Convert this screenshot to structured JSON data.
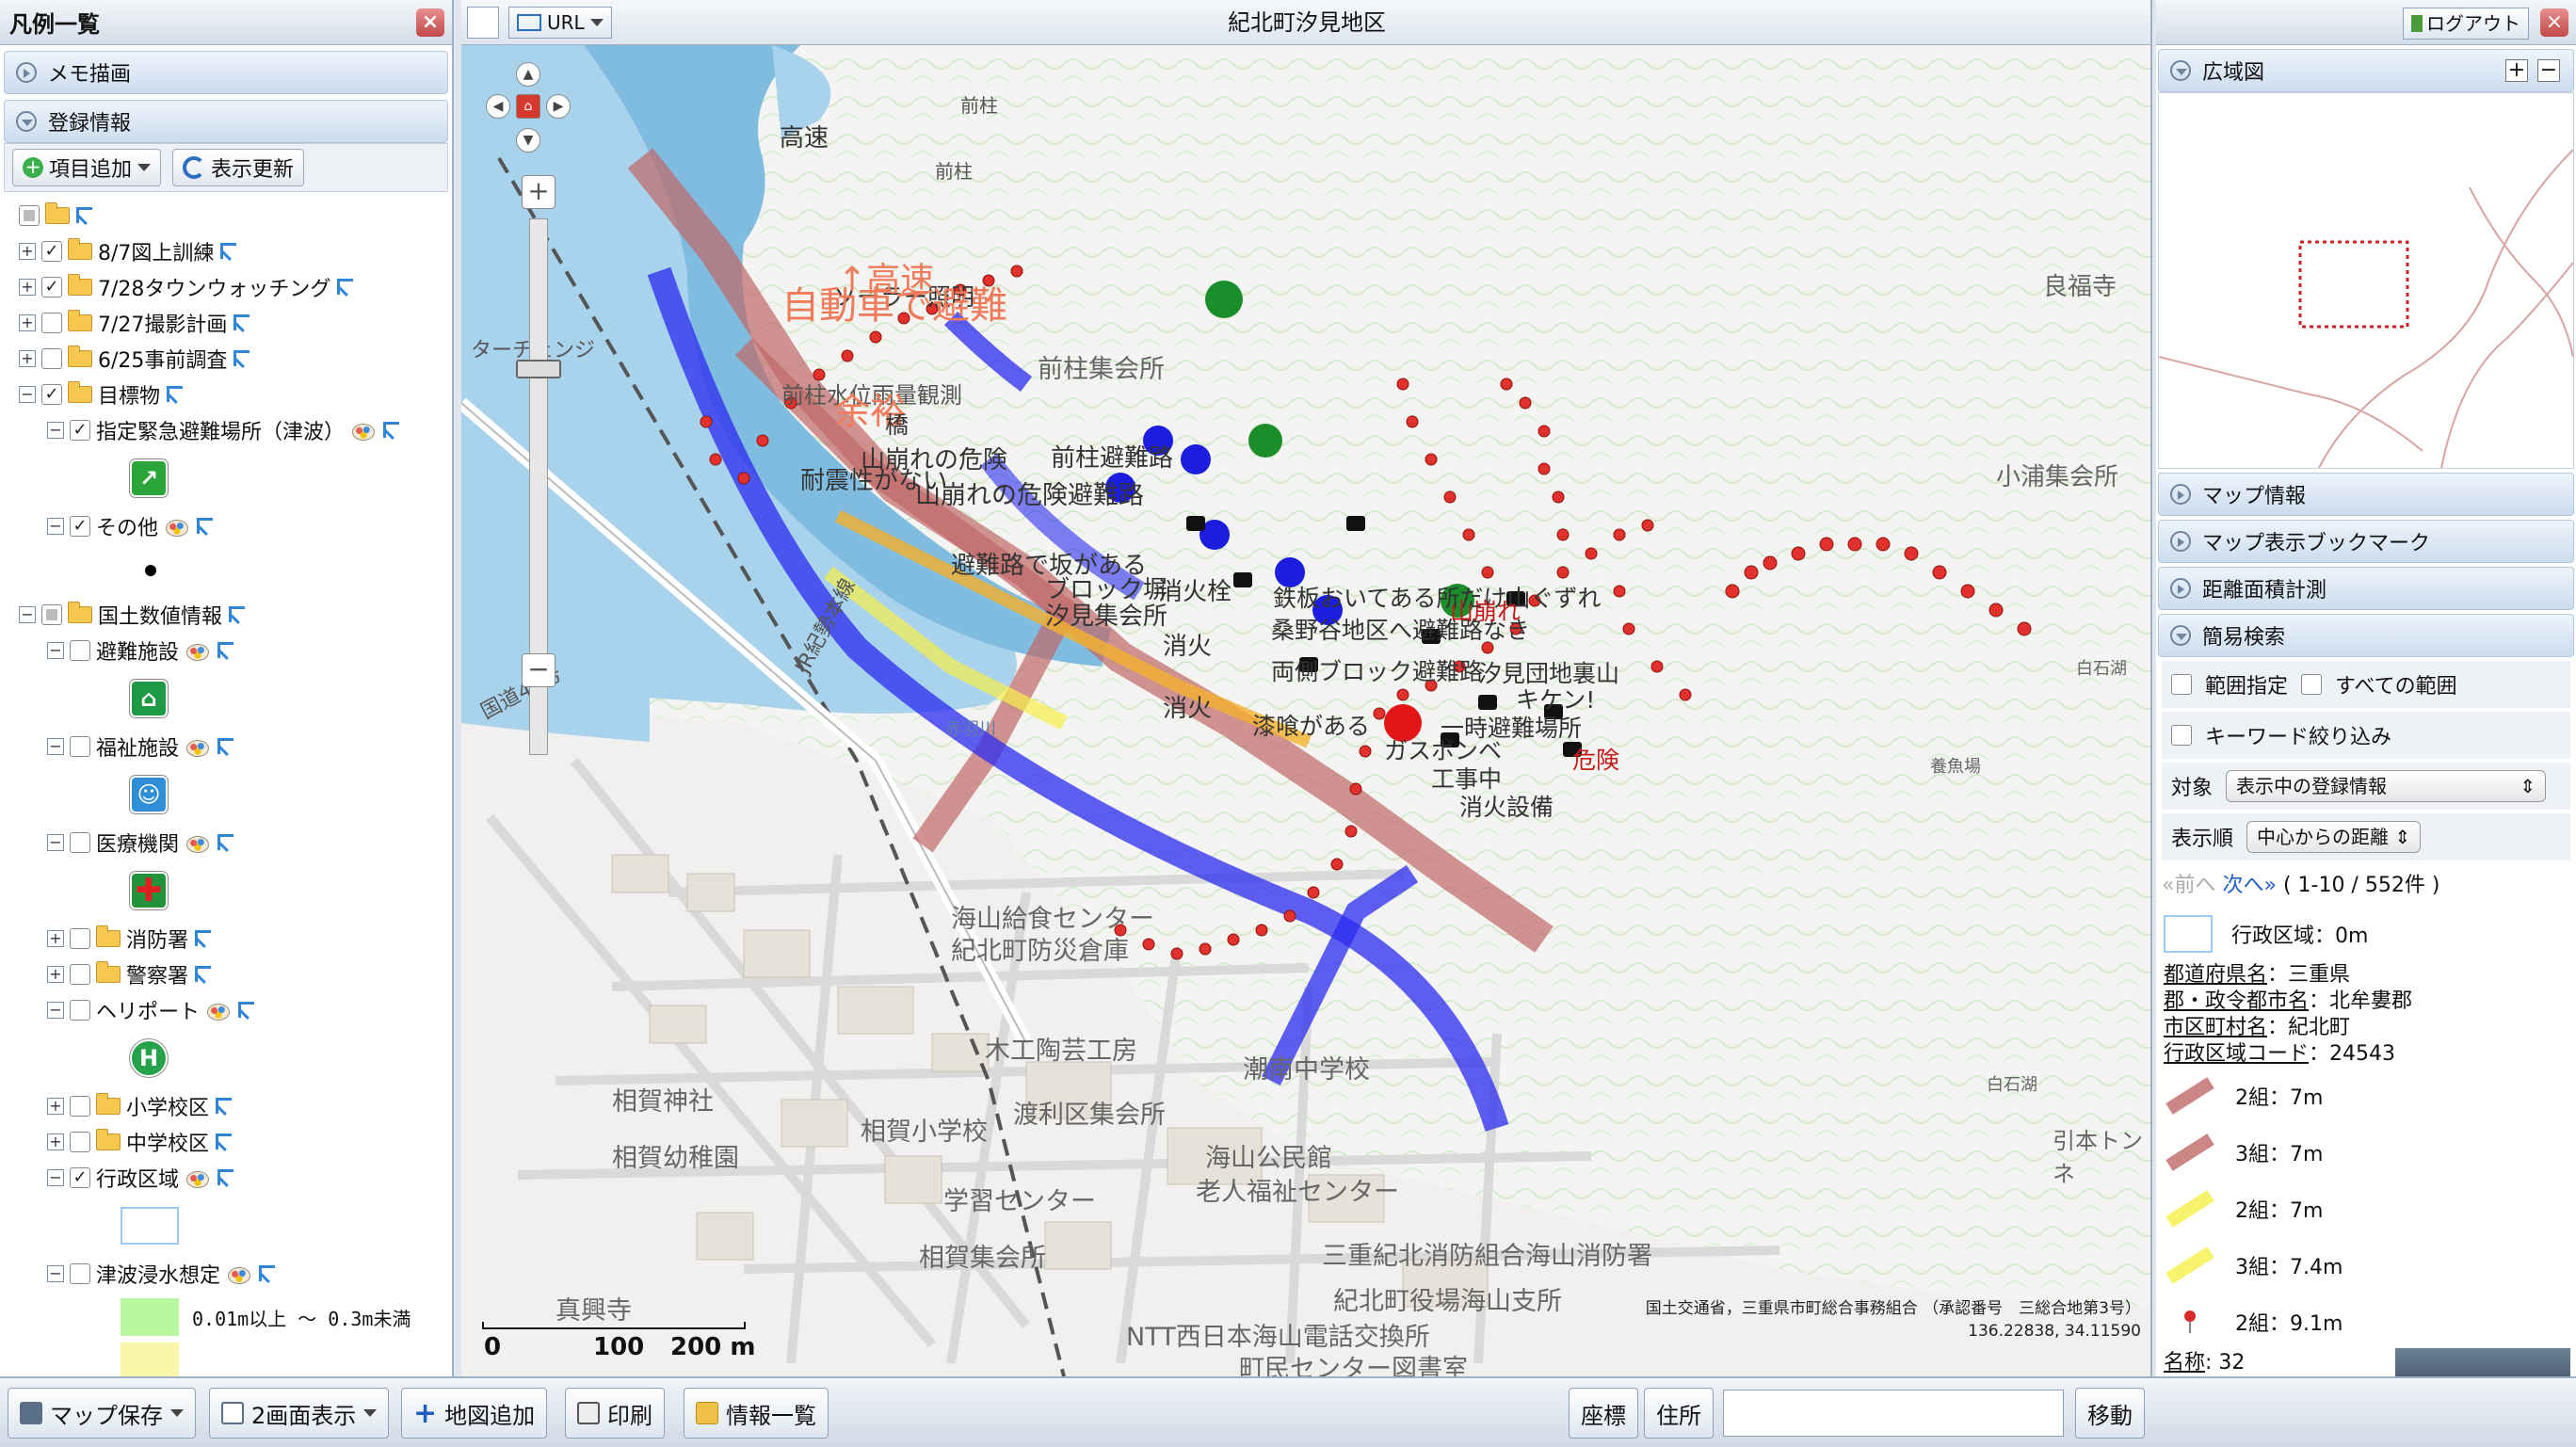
{
  "left_panel": {
    "title": "凡例一覧",
    "memo_section": "メモ描画",
    "reg_section": "登録情報",
    "add_item": "項目追加",
    "refresh": "表示更新",
    "tree": {
      "n1": "8/7図上訓練",
      "n2": "7/28タウンウォッチング",
      "n3": "7/27撮影計画",
      "n4": "6/25事前調査",
      "n5": "目標物",
      "n5a": "指定緊急避難場所（津波）",
      "n5b": "その他",
      "n6": "国土数値情報",
      "n6a": "避難施設",
      "n6b": "福祉施設",
      "n6c": "医療機関",
      "n6d": "消防署",
      "n6e": "警察署",
      "n6f": "ヘリポート",
      "n6g": "小学校区",
      "n6h": "中学校区",
      "n6i": "行政区域",
      "n6j": "津波浸水想定",
      "flood1": "0.01m以上 ～ 0.3m未満"
    }
  },
  "map": {
    "title": "紀北町汐見地区",
    "url_label": "URL",
    "labels": {
      "kosoku": "高速",
      "maebashi_top": "前柱",
      "maebashi2": "前柱",
      "solar": "ソーラー照明",
      "kosoku_arrow": "↑高速",
      "jidousha": "自動車で避難",
      "maebashi_hall": "前柱集会所",
      "rain": "前柱水位雨量観測",
      "yoyu": "余裕",
      "bridge": "橋",
      "landslide1": "山崩れの危険",
      "maebashi_route": "前柱避難路",
      "taishin": "耐震性がない",
      "landslide2": "山崩れの危険避難路",
      "route_slope": "避難路で坂がある",
      "shiomi_hall": "汐見集会所",
      "block": "ブロック塀",
      "fire1": "消火栓",
      "fire2": "消火",
      "fire3": "消火",
      "tetsu": "鉄板おいてある所だけ山ぐずれ",
      "kuwabara": "桑野谷地区へ避難路なき",
      "kuzure": "山崩れ",
      "ryogawa": "両側ブロック避難路",
      "danchi": "汐見団地裏山",
      "kiken": "キケン!",
      "shikkui": "漆喰がある",
      "fire_equip": "消火設備",
      "gas": "ガスボンベ",
      "ichiji": "一時避難場所",
      "koji": "工事中",
      "kiken2": "危険",
      "yorafuku": "良福寺",
      "koura": "小浦集会所",
      "shiroishi": "白石湖",
      "shiroishi2": "白石湖",
      "yogyojo": "養魚場",
      "kaizan_kyushoku": "海山給食センター",
      "bosai": "紀北町防災倉庫",
      "mokko": "木工陶芸工房",
      "choonan": "潮南中学校",
      "aika_jinja": "相賀神社",
      "aika_sho": "相賀小学校",
      "watari": "渡利区集会所",
      "aika_yochi": "相賀幼稚園",
      "kaizan_kominkan": "海山公民館",
      "rojin": "老人福祉センター",
      "gakushu": "学習センター",
      "aika_shukai": "相賀集会所",
      "kaizan_fire": "三重紀北消防組合海山消防署",
      "yakuba": "紀北町役場海山支所",
      "ntt": "NTT西日本海山電話交換所",
      "machimin": "町民センター図書室",
      "shinkoji": "真興寺",
      "interchange": "ターチェンジ",
      "kokudo": "国道42号",
      "ur_line": "JR紀勢本線",
      "akasu": "赤羽川",
      "hikimoto": "引本トンネ"
    },
    "scale_labels": [
      "0",
      "100",
      "200 m"
    ],
    "attribution": "国土交通省，三重県市町総合事務組合 （承認番号　三総合地第3号）",
    "coords": "136.22838, 34.11590"
  },
  "right_panel": {
    "logout": "ログアウト",
    "overview": "広域図",
    "map_info": "マップ情報",
    "bookmark": "マップ表示ブックマーク",
    "measure": "距離面積計測",
    "simple_search": "簡易検索",
    "range": "範囲指定",
    "all_range": "すべての範囲",
    "keyword": "キーワード絞り込み",
    "target_label": "対象",
    "target_value": "表示中の登録情報",
    "order_label": "表示順",
    "order_value": "中心からの距離",
    "prev": "«前へ",
    "next": "次へ»",
    "count": "( 1-10 / 552件 )",
    "results": {
      "r1": "行政区域：0m",
      "r2": "2組：7m",
      "r3": "3組：7m",
      "r4": "2組：7m",
      "r5": "3組：7.4m",
      "r6": "2組：9.1m"
    },
    "attrs": {
      "pref_k": "都道府県名",
      "pref_v": "：三重県",
      "gun_k": "郡・政令都市名",
      "gun_v": "：北牟婁郡",
      "city_k": "市区町村名",
      "city_v": "：紀北町",
      "code_k": "行政区域コード",
      "code_v": "：24543",
      "name_k": "名称",
      "name_v": ": 32"
    }
  },
  "bottom_bar": {
    "save": "マップ保存",
    "dual": "2画面表示",
    "add_map": "地図追加",
    "print": "印刷",
    "info_list": "情報一覧",
    "coord_btn": "座標",
    "addr_btn": "住所",
    "search_value": "",
    "move_btn": "移動"
  }
}
